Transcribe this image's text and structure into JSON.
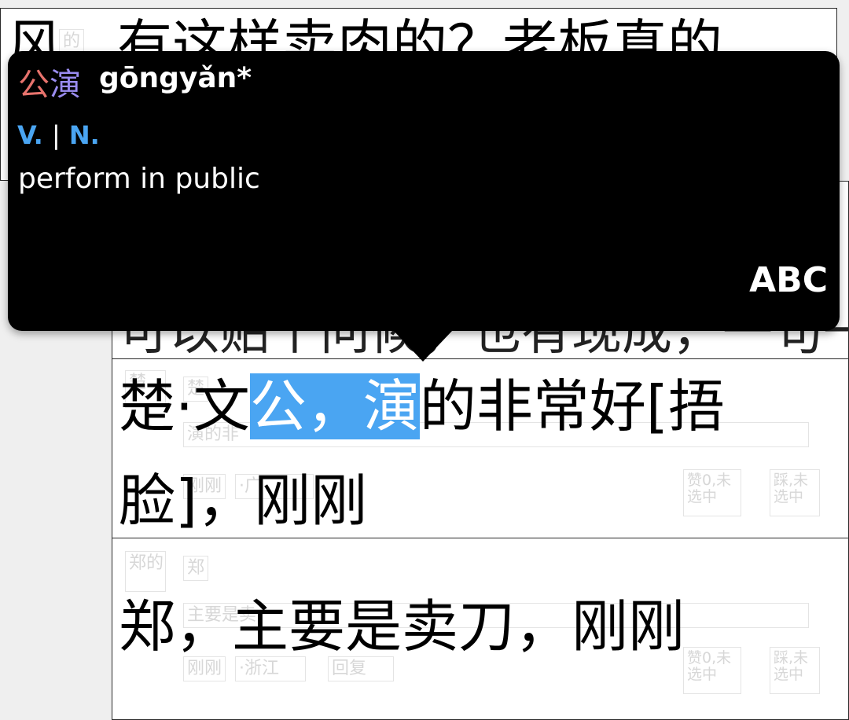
{
  "cell_top": {
    "text": "风，有这样卖肉的？老板真的",
    "ghost_label": "的"
  },
  "cell_mid": {
    "text": "可以贴个问候，也有现成，一句一句的"
  },
  "cell_chu": {
    "line1_pre": "楚·文",
    "selection_a": "公，",
    "selection_b": "演",
    "line1_post": "的非常好[捂",
    "line2": "脸]，刚刚",
    "ghost_name": "楚",
    "ghost_sub": "楚",
    "ghost_quote": "演的非",
    "ghost_footer_a": "刚刚",
    "ghost_footer_b": "·广",
    "ghost_like": "赞0,未选中",
    "ghost_dislike": "踩,未选中"
  },
  "cell_zheng": {
    "text": "郑，主要是卖刀，刚刚",
    "ghost_name": "郑的",
    "ghost_sub": "郑",
    "ghost_quote": "主要是卖",
    "ghost_footer_a": "刚刚",
    "ghost_footer_b": "·浙江",
    "ghost_reply": "回复",
    "ghost_like": "赞0,未选中",
    "ghost_dislike": "踩,未选中"
  },
  "popup": {
    "char1": "公",
    "char2": "演",
    "pinyin": "gōngyǎn*",
    "pos_v": "V.",
    "pos_sep": "|",
    "pos_n": "N.",
    "definition": "perform in public",
    "abc": "ABC",
    "colors": {
      "char1": "#e8736d",
      "char2": "#9a8cf0",
      "pos": "#4aa5f2",
      "highlight": "#4aa5f2"
    }
  }
}
